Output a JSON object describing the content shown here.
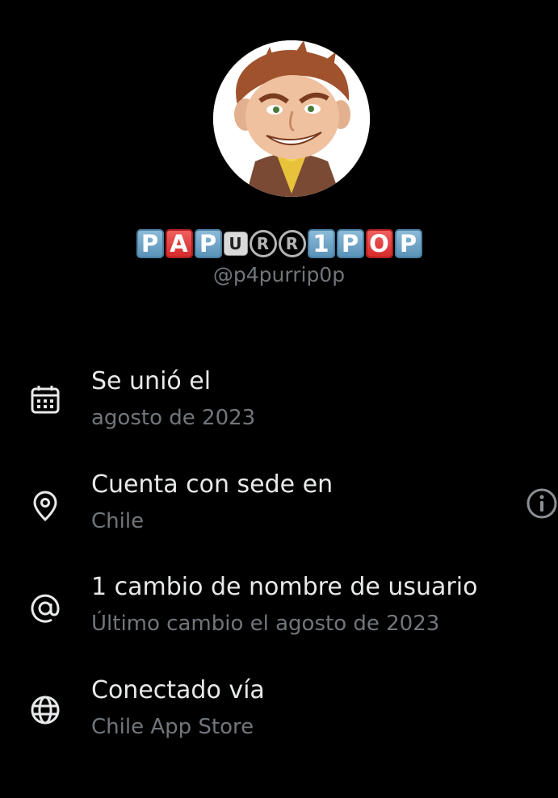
{
  "profile": {
    "display_name_tiles": [
      "P",
      "A",
      "P",
      "U",
      "R",
      "R",
      "1",
      "P",
      "O",
      "P"
    ],
    "handle": "@p4purrip0p"
  },
  "about": [
    {
      "icon": "calendar-icon",
      "title": "Se unió el",
      "subtitle": "agosto de 2023"
    },
    {
      "icon": "location-pin-icon",
      "title": "Cuenta con sede en",
      "subtitle": "Chile"
    },
    {
      "icon": "at-sign-icon",
      "title": "1 cambio de nombre de usuario",
      "subtitle": "Último cambio el agosto de 2023"
    },
    {
      "icon": "globe-icon",
      "title": "Conectado vía",
      "subtitle": "Chile App Store"
    }
  ],
  "colors": {
    "background": "#000000",
    "primary_text": "#e7e9ea",
    "secondary_text": "#71767b"
  }
}
